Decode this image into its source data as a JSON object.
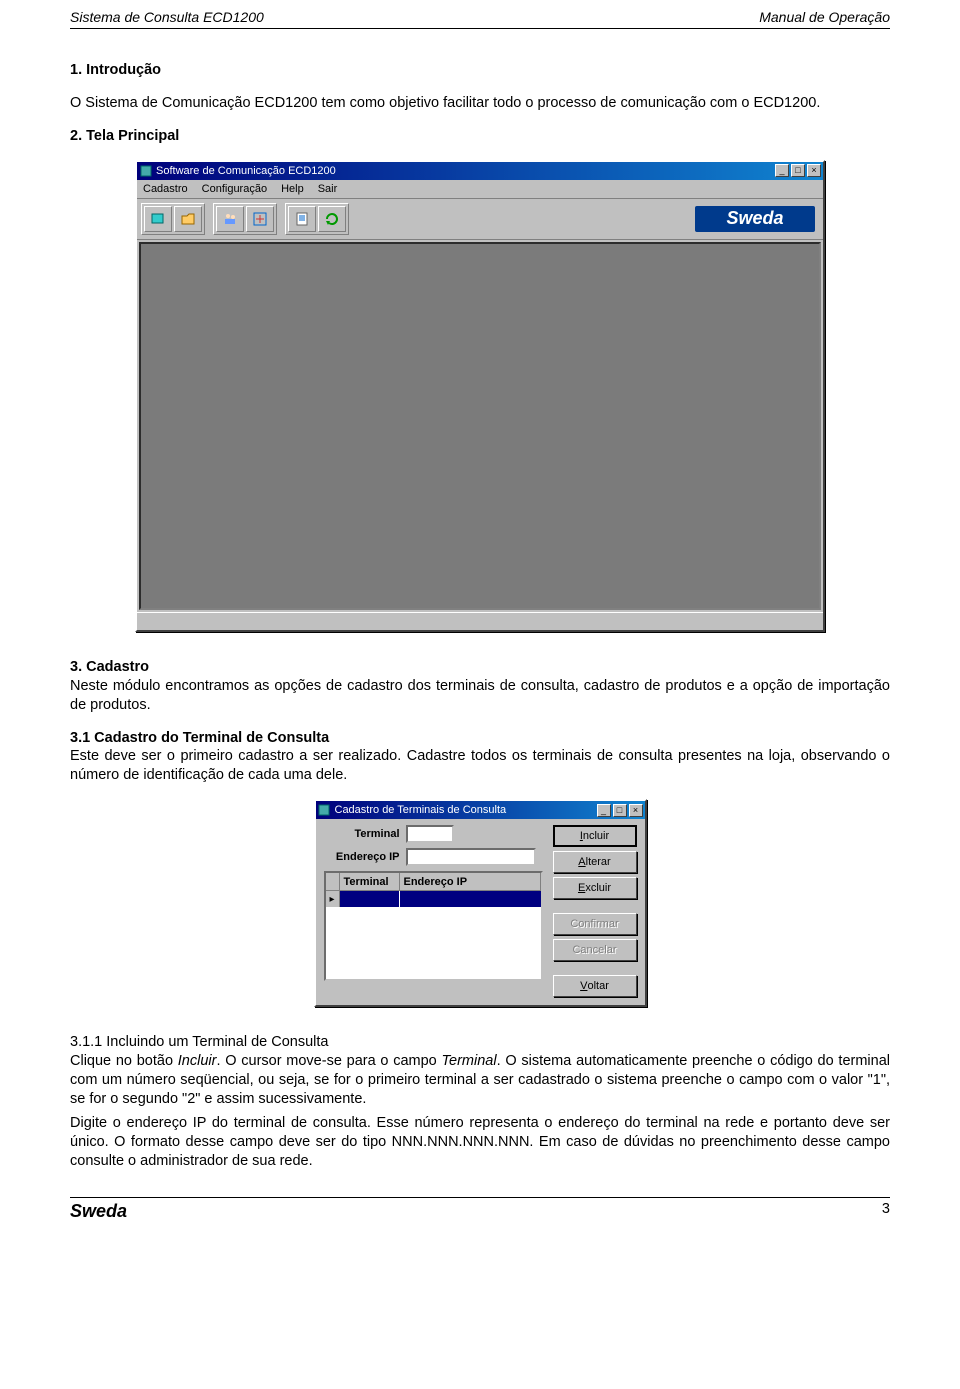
{
  "header": {
    "left": "Sistema de Consulta ECD1200",
    "right": "Manual de Operação"
  },
  "sections": {
    "s1_title": "1. Introdução",
    "s1_body": "O Sistema de Comunicação ECD1200 tem como objetivo facilitar todo o processo de comunicação com o ECD1200.",
    "s2_title": "2. Tela Principal",
    "s3_title": "3. Cadastro",
    "s3_body": "Neste módulo encontramos as opções de cadastro dos terminais de consulta, cadastro de produtos e a opção de importação de produtos.",
    "s31_title": "3.1 Cadastro do Terminal de Consulta",
    "s31_body": "Este deve ser o primeiro cadastro a ser realizado.  Cadastre todos os terminais de consulta presentes na loja, observando o número de identificação de cada uma dele.",
    "s311_title": "3.1.1 Incluindo um Terminal de Consulta",
    "s311_p1a": "Clique no botão ",
    "s311_p1b": "Incluir",
    "s311_p1c": ". O cursor move-se para o campo ",
    "s311_p1d": "Terminal",
    "s311_p1e": ". O sistema automaticamente preenche o código do terminal com um número seqüencial, ou seja, se for o primeiro terminal a ser cadastrado o sistema preenche o campo com o valor \"1\", se for o segundo \"2\" e assim sucessivamente.",
    "s311_p2": "Digite o endereço IP do terminal de consulta. Esse número representa o endereço do terminal na rede e portanto deve ser único. O formato desse campo deve ser do tipo NNN.NNN.NNN.NNN. Em caso de dúvidas no preenchimento desse campo consulte o administrador de sua rede."
  },
  "main_app": {
    "title": "Software de Comunicação ECD1200",
    "menus": {
      "m1": "Cadastro",
      "m2": "Configuração",
      "m3": "Help",
      "m4": "Sair"
    },
    "brand": "Sweda",
    "toolbar_icons": [
      "folder-icon",
      "open-folder-icon",
      "separator",
      "users-icon",
      "tools-icon",
      "separator",
      "report-icon",
      "refresh-icon"
    ]
  },
  "dialog": {
    "title": "Cadastro de Terminais de Consulta",
    "labels": {
      "terminal": "Terminal",
      "ip": "Endereço IP"
    },
    "grid_cols": {
      "c1": "Terminal",
      "c2": "Endereço IP"
    },
    "buttons": {
      "incluir": "Incluir",
      "alterar": "Alterar",
      "excluir": "Excluir",
      "confirmar": "Confirmar",
      "cancelar": "Cancelar",
      "voltar": "Voltar"
    },
    "window_buttons": {
      "min": "_",
      "max": "□",
      "close": "×"
    }
  },
  "footer": {
    "brand": "Sweda",
    "page": "3"
  }
}
